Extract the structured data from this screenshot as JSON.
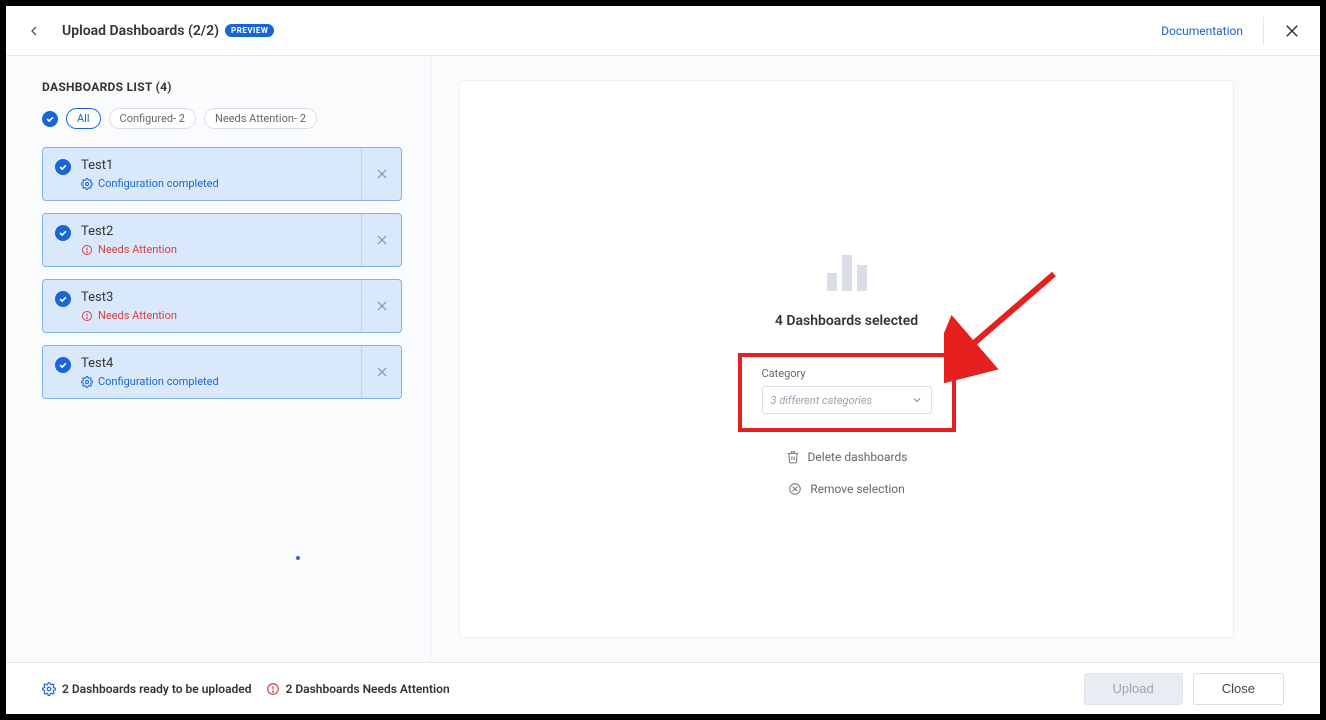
{
  "header": {
    "title": "Upload Dashboards (2/2)",
    "badge": "PREVIEW",
    "documentation": "Documentation"
  },
  "sidebar": {
    "list_title": "DASHBOARDS LIST (4)",
    "filters": {
      "all": "All",
      "configured": "Configured- 2",
      "needs_attention": "Needs Attention- 2"
    },
    "items": [
      {
        "name": "Test1",
        "status_kind": "ok",
        "status_text": "Configuration completed"
      },
      {
        "name": "Test2",
        "status_kind": "warn",
        "status_text": "Needs Attention"
      },
      {
        "name": "Test3",
        "status_kind": "warn",
        "status_text": "Needs Attention"
      },
      {
        "name": "Test4",
        "status_kind": "ok",
        "status_text": "Configuration completed"
      }
    ]
  },
  "panel": {
    "selected_title": "4 Dashboards selected",
    "category_label": "Category",
    "category_placeholder": "3 different categories",
    "delete_label": "Delete dashboards",
    "remove_label": "Remove selection"
  },
  "footer": {
    "ready": "2 Dashboards ready to be uploaded",
    "attention": "2 Dashboards Needs Attention",
    "upload": "Upload",
    "close": "Close"
  },
  "colors": {
    "accent": "#1765d8",
    "warn": "#d93d3d",
    "highlight": "#e6201f"
  }
}
